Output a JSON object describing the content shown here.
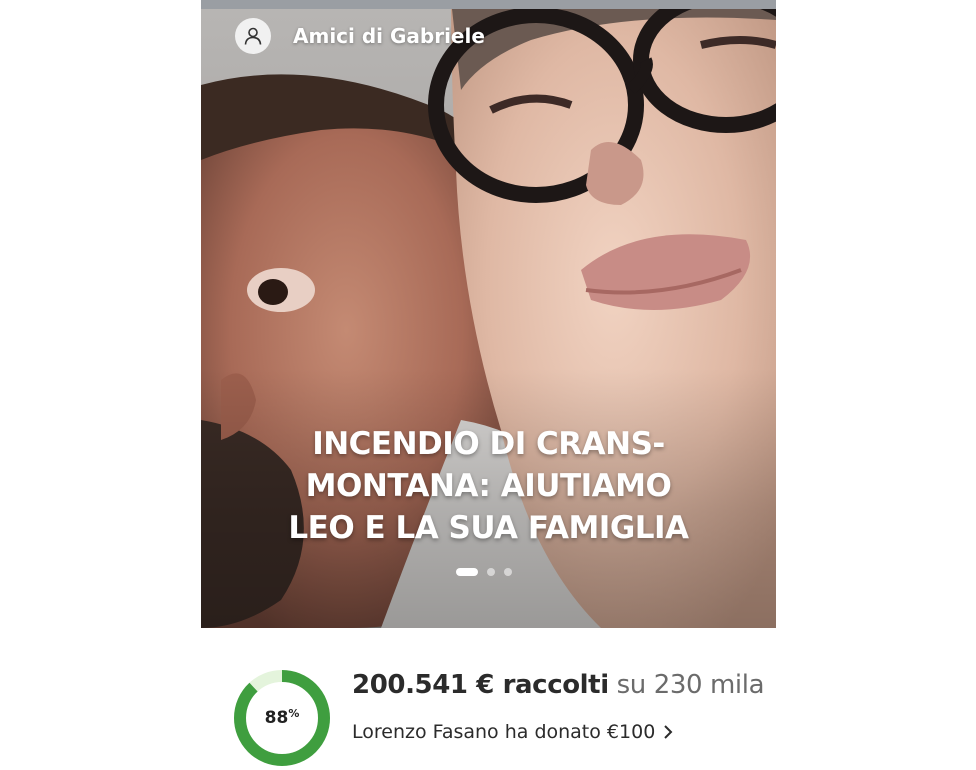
{
  "organizer": {
    "name": "Amici di Gabriele",
    "icon": "user-icon"
  },
  "campaign": {
    "title": "INCENDIO DI CRANS-MONTANA: AIUTIAMO LEO E LA SUA FAMIGLIA"
  },
  "carousel": {
    "total_slides": 3,
    "active_slide": 1
  },
  "progress": {
    "percent_number": "88",
    "percent_sign": "%",
    "fraction": 0.88,
    "ring_color": "#3f9e3f",
    "ring_track_color": "#e4f4dc",
    "raised_amount": "200.541 € raccolti",
    "goal_text": "su 230 mila"
  },
  "latest_donation": {
    "text": "Lorenzo Fasano ha donato €100",
    "icon": "chevron-right-icon"
  }
}
